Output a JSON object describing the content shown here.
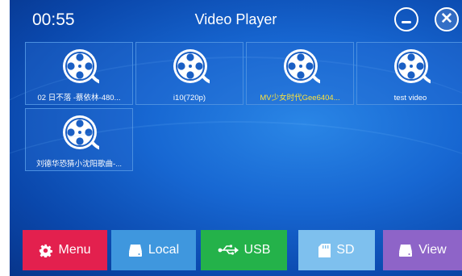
{
  "status": {
    "time": "00:55"
  },
  "window": {
    "title": "Video Player"
  },
  "files": [
    {
      "name": "02 日不落 -蔡依林-480...",
      "color": "#ffffff"
    },
    {
      "name": "i10(720p)",
      "color": "#ffffff"
    },
    {
      "name": "MV少女时代Gee6404...",
      "color": "#ffe23a"
    },
    {
      "name": "test video",
      "color": "#ffffff"
    },
    {
      "name": "刘德华恐猜小沈阳歌曲-...",
      "color": "#ffffff"
    }
  ],
  "toolbar": {
    "menu": {
      "label": "Menu",
      "icon": "gear-icon",
      "color": "#e3204e"
    },
    "local": {
      "label": "Local",
      "icon": "drive-icon",
      "color": "#3f97de"
    },
    "usb": {
      "label": "USB",
      "icon": "usb-icon",
      "color": "#24b24a"
    },
    "sd": {
      "label": "SD",
      "icon": "sd-card-icon",
      "color": "#7ec0ee"
    },
    "view": {
      "label": "View",
      "icon": "drive-icon",
      "color": "#8e64c8"
    }
  }
}
